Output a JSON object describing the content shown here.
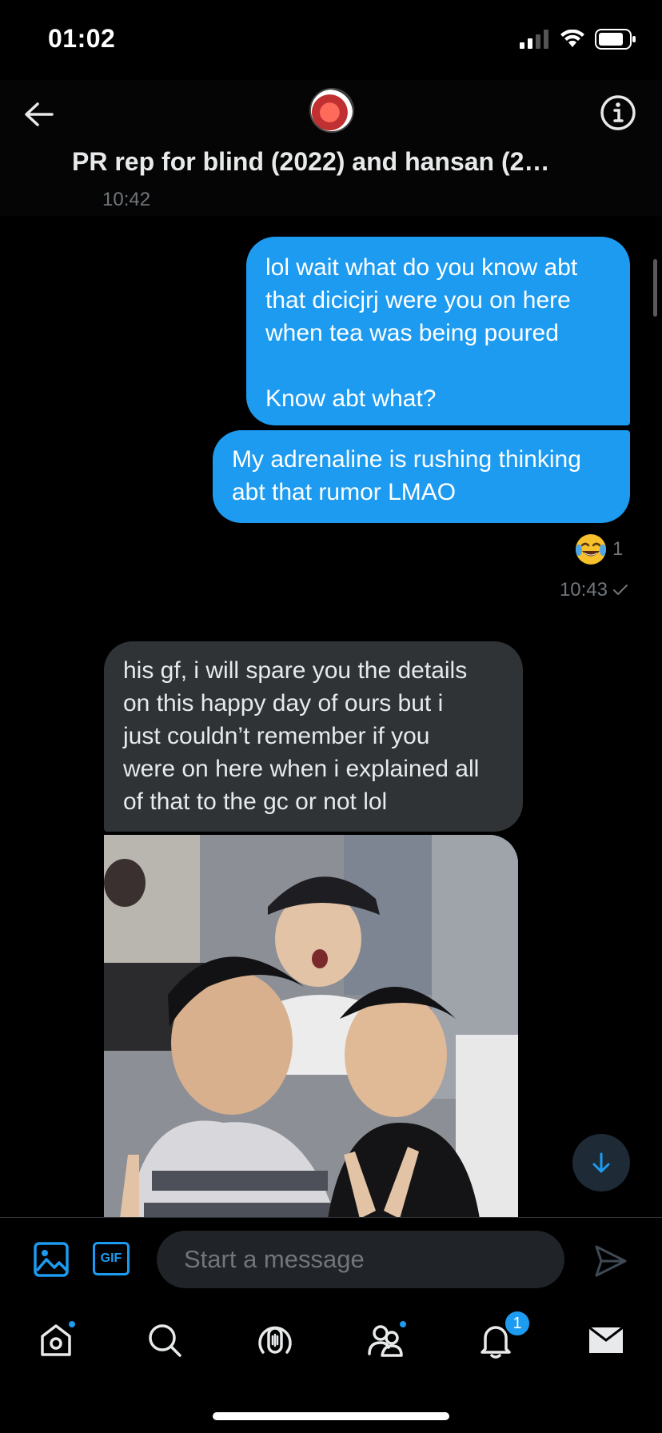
{
  "status_bar": {
    "time": "01:02"
  },
  "header": {
    "title": "PR rep for blind (2022) and hansan (2…",
    "timestamp": "10:42"
  },
  "messages": {
    "outgoing_1": {
      "line1": "lol wait what do you know abt",
      "line2": "that dicicjrj were you on here",
      "line3": "when tea was being poured",
      "line4": "Know abt what?"
    },
    "outgoing_2": {
      "line1": "My adrenaline is rushing thinking",
      "line2": "abt that rumor LMAO"
    },
    "reaction": {
      "emoji": "😂",
      "count": "1"
    },
    "outgoing_time": "10:43",
    "incoming_1": {
      "line1": "his gf, i will spare you the details",
      "line2": "on this happy day of ours but i",
      "line3": "just couldn’t remember if you",
      "line4": "were on here when i explained all",
      "line5": "of that to the gc or not lol"
    }
  },
  "composer": {
    "placeholder": "Start a message",
    "gif_label": "GIF"
  },
  "bottom_nav": {
    "notifications_badge": "1"
  },
  "colors": {
    "accent": "#1d9bf0",
    "incoming_bubble": "#2f3336",
    "background": "#000000"
  }
}
